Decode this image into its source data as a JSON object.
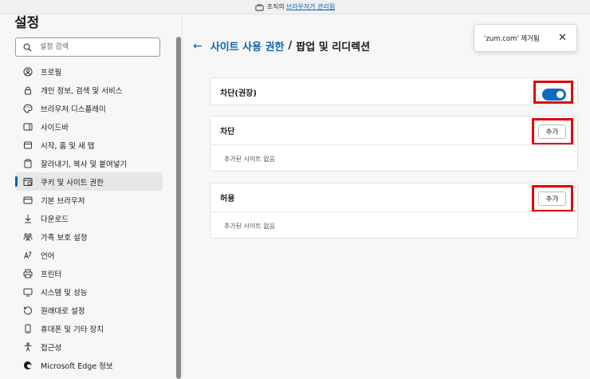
{
  "banner": {
    "text": "조직의",
    "link": "브라우저가 관리됨"
  },
  "sidebar": {
    "title": "설정",
    "search_placeholder": "설정 검색",
    "items": [
      {
        "label": "프로필",
        "icon": "profile-icon"
      },
      {
        "label": "개인 정보, 검색 및 서비스",
        "icon": "lock-icon"
      },
      {
        "label": "브라우저 디스플레이",
        "icon": "palette-icon"
      },
      {
        "label": "사이드바",
        "icon": "sidebar-icon"
      },
      {
        "label": "시작, 홈 및 새 탭",
        "icon": "home-icon"
      },
      {
        "label": "잘라내기, 복사 및 붙여넣기",
        "icon": "clipboard-icon"
      },
      {
        "label": "쿠키 및 사이트 권한",
        "icon": "cookie-icon",
        "active": true
      },
      {
        "label": "기본 브라우저",
        "icon": "browser-icon"
      },
      {
        "label": "다운로드",
        "icon": "download-icon"
      },
      {
        "label": "가족 보호 설정",
        "icon": "family-icon"
      },
      {
        "label": "언어",
        "icon": "language-icon"
      },
      {
        "label": "프린터",
        "icon": "printer-icon"
      },
      {
        "label": "시스템 및 성능",
        "icon": "system-icon"
      },
      {
        "label": "원래대로 설정",
        "icon": "reset-icon"
      },
      {
        "label": "휴대폰 및 기타 장치",
        "icon": "phone-icon"
      },
      {
        "label": "접근성",
        "icon": "accessibility-icon"
      },
      {
        "label": "Microsoft Edge 정보",
        "icon": "edge-icon"
      }
    ]
  },
  "header": {
    "parent": "사이트 사용 권한",
    "separator": "/",
    "current": "팝업 및 리디렉션"
  },
  "toast": {
    "message": "'zum.com' 제거됨",
    "close": "✕"
  },
  "settings": {
    "block_recommended": {
      "label": "차단(권장)",
      "enabled": true
    },
    "block": {
      "title": "차단",
      "add_label": "추가",
      "empty": "추가된 사이트 없음"
    },
    "allow": {
      "title": "허용",
      "add_label": "추가",
      "empty": "추가된 사이트 없음"
    }
  },
  "colors": {
    "accent": "#0f62b0",
    "highlight": "#e0000b",
    "toggle_on": "#0f6cbd"
  }
}
